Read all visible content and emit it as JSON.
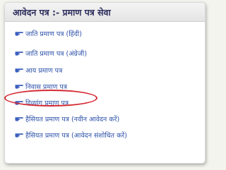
{
  "panel": {
    "title": "आवेदन पत्र :-  प्रमाण पत्र सेवा"
  },
  "links": [
    {
      "label": "जाति प्रमाण पत्र (हिंदी)",
      "icon": "pointing-hand-icon"
    },
    {
      "label": "जाति प्रमाण पत्र (अंग्रेजी)",
      "icon": "pointing-hand-icon"
    },
    {
      "label": "आय प्रमाण पत्र",
      "icon": "pointing-hand-icon"
    },
    {
      "label": "निवास प्रमाण पत्र",
      "icon": "pointing-hand-icon"
    },
    {
      "label": "दिव्यांग प्रमाण पत्र",
      "icon": "pointing-hand-icon",
      "highlighted": true
    },
    {
      "label": "हैसियत प्रमाण पत्र (नवीन आवेदन करें)",
      "icon": "pointing-hand-icon"
    },
    {
      "label": "हैसियत प्रमाण पत्र (आवेदन संशोधित करें)",
      "icon": "pointing-hand-icon"
    }
  ],
  "colors": {
    "link_text": "#2a4fa8",
    "icon": "#3a5fc0",
    "highlight": "#d42a32",
    "title_text": "#2e2e5e"
  }
}
